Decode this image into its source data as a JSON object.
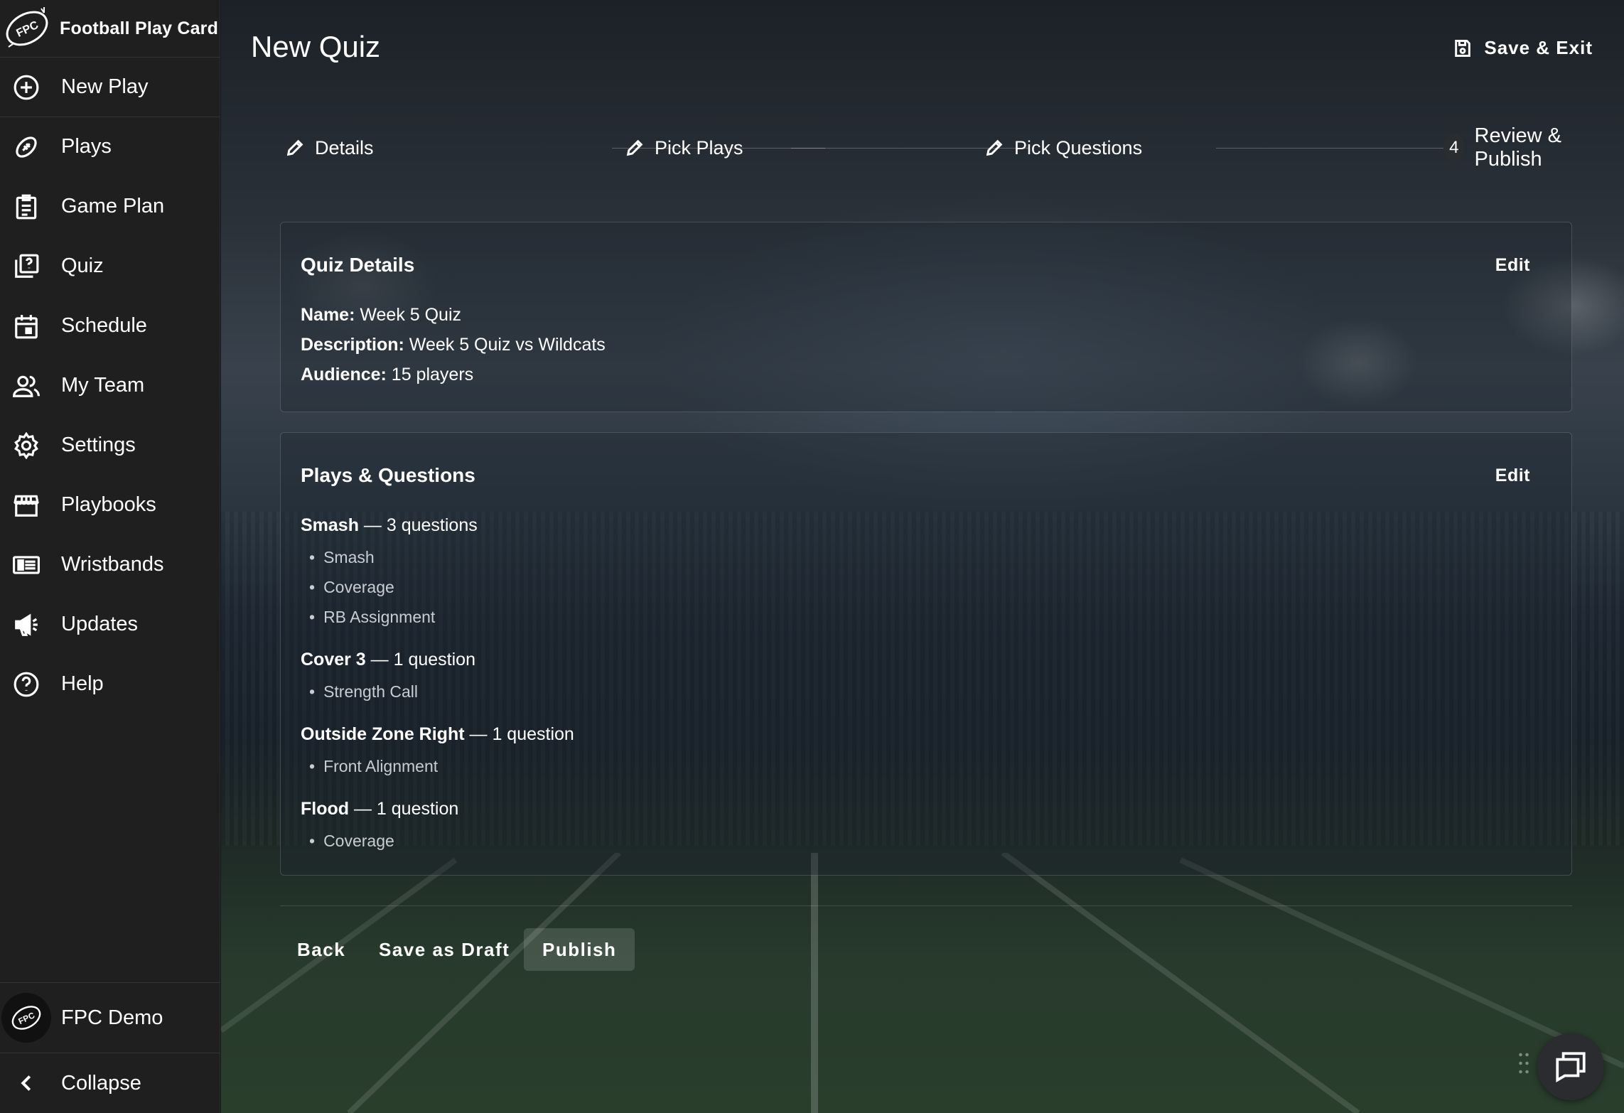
{
  "app": {
    "title": "Football Play Card",
    "logo_text": "FPC"
  },
  "sidebar": {
    "items": [
      {
        "label": "New Play",
        "icon": "plus-circle-icon"
      },
      {
        "label": "Plays",
        "icon": "football-icon"
      },
      {
        "label": "Game Plan",
        "icon": "clipboard-icon"
      },
      {
        "label": "Quiz",
        "icon": "quiz-icon"
      },
      {
        "label": "Schedule",
        "icon": "calendar-icon"
      },
      {
        "label": "My Team",
        "icon": "team-icon"
      },
      {
        "label": "Settings",
        "icon": "gear-icon"
      },
      {
        "label": "Playbooks",
        "icon": "store-icon"
      },
      {
        "label": "Wristbands",
        "icon": "wristband-icon"
      },
      {
        "label": "Updates",
        "icon": "megaphone-icon"
      },
      {
        "label": "Help",
        "icon": "help-icon"
      }
    ],
    "user_name": "FPC Demo",
    "collapse_label": "Collapse"
  },
  "header": {
    "title": "New Quiz",
    "save_exit_label": "Save & Exit"
  },
  "stepper": {
    "steps": [
      {
        "label": "Details",
        "state": "edit"
      },
      {
        "label": "Pick Plays",
        "state": "edit"
      },
      {
        "label": "Pick Questions",
        "state": "edit"
      },
      {
        "label": "Review & Publish",
        "state": "active",
        "number": "4"
      }
    ]
  },
  "quiz_details": {
    "title": "Quiz Details",
    "edit_label": "Edit",
    "name_label": "Name:",
    "name_value": " Week 5 Quiz",
    "description_label": "Description:",
    "description_value": " Week 5 Quiz vs Wildcats",
    "audience_label": "Audience:",
    "audience_value": " 15 players"
  },
  "plays_questions": {
    "title": "Plays & Questions",
    "edit_label": "Edit",
    "plays": [
      {
        "name": "Smash",
        "count": " — 3 questions",
        "questions": [
          "Smash",
          "Coverage",
          "RB Assignment"
        ]
      },
      {
        "name": "Cover 3",
        "count": " — 1 question",
        "questions": [
          "Strength Call"
        ]
      },
      {
        "name": "Outside Zone Right",
        "count": " — 1 question",
        "questions": [
          "Front Alignment"
        ]
      },
      {
        "name": "Flood",
        "count": " — 1 question",
        "questions": [
          "Coverage"
        ]
      }
    ]
  },
  "footer": {
    "back_label": "Back",
    "draft_label": "Save as Draft",
    "publish_label": "Publish"
  },
  "colors": {
    "sidebar_bg": "#1f1f1f",
    "text": "#ffffff",
    "muted_text": "#c9cdd2"
  }
}
